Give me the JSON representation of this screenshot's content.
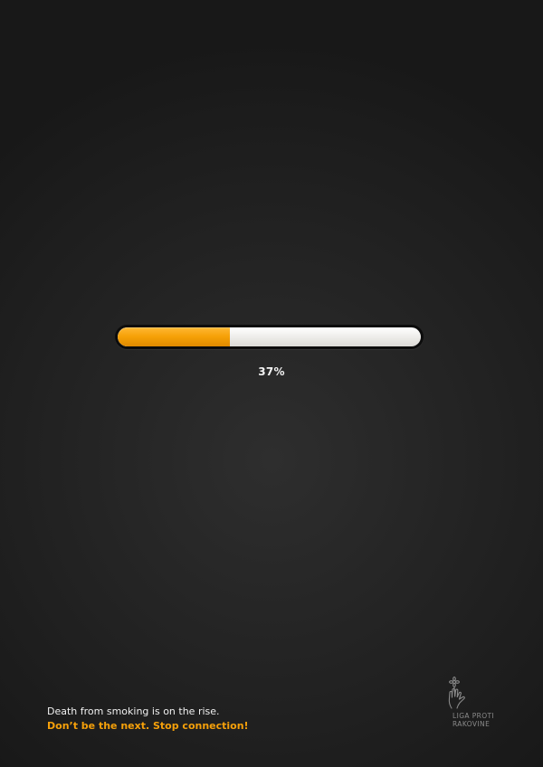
{
  "progress": {
    "value_percent": 37,
    "label": "37%",
    "fill_color": "#f5a006",
    "track_color": "#ecebe8"
  },
  "caption": {
    "line1": "Death from smoking is on the rise.",
    "line2": "Don’t be the next. Stop connection!"
  },
  "logo": {
    "line1": "LIGA PROTI",
    "line2": "RAKOVINE",
    "icon": "hand-flower-icon"
  },
  "colors": {
    "background": "#242424",
    "accent": "#f5a00a",
    "text": "#f0f0f0"
  }
}
